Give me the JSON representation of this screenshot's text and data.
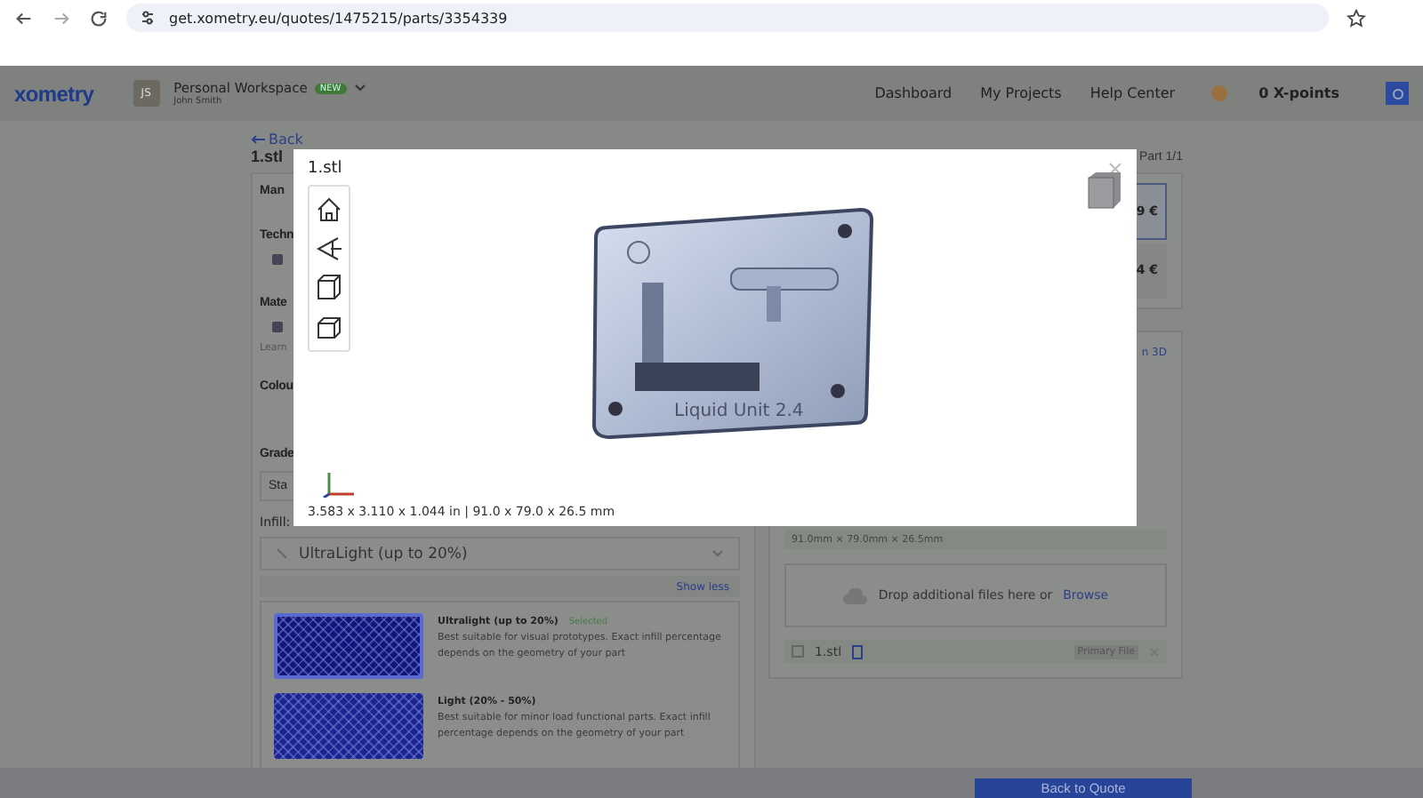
{
  "browser": {
    "url": "get.xometry.eu/quotes/1475215/parts/3354339"
  },
  "header": {
    "logo": "xometry",
    "workspace": {
      "initials": "JS",
      "name": "Personal Workspace",
      "badge": "NEW",
      "user": "John Smith"
    },
    "nav": [
      "Dashboard",
      "My Projects",
      "Help Center"
    ],
    "points": "0 X-points"
  },
  "page": {
    "back": "Back",
    "title": "1.stl",
    "part_counter": "Part 1/1"
  },
  "config": {
    "heading": "Man",
    "fields": [
      {
        "kind": "icon",
        "label": "Techn"
      },
      {
        "kind": "icon",
        "label": "Mate",
        "note": "Learn"
      },
      {
        "kind": "empty",
        "label": "Colou"
      },
      {
        "kind": "select",
        "label": "Grade",
        "value": "Sta"
      }
    ]
  },
  "infill": {
    "label": "Infill:",
    "value": "UltraLight (up to 20%)",
    "toggle": "Show less",
    "selected_label": "Selected",
    "options": [
      {
        "name": "Ultralight (up to 20%)",
        "selected": true,
        "description": "Best suitable for visual prototypes. Exact infill percentage depends on the geometry of your part"
      },
      {
        "name": "Light (20% - 50%)",
        "selected": false,
        "description": "Best suitable for minor load functional parts. Exact infill percentage depends on the geometry of your part"
      }
    ]
  },
  "prices": [
    {
      "amount": "9 €",
      "selected": true
    },
    {
      "amount": "4 €",
      "selected": false
    }
  ],
  "preview": {
    "link": "n 3D",
    "dimensions": "91.0mm × 79.0mm × 26.5mm",
    "drop_text": "Drop additional files here or",
    "browse": "Browse",
    "file": {
      "name": "1.stl",
      "tag": "Primary File"
    }
  },
  "footer": {
    "button": "Back to Quote"
  },
  "modal": {
    "title": "1.stl",
    "model_label": "Liquid Unit 2.4",
    "dimensions": "3.583 x 3.110 x 1.044 in | 91.0 x 79.0 x 26.5 mm"
  }
}
